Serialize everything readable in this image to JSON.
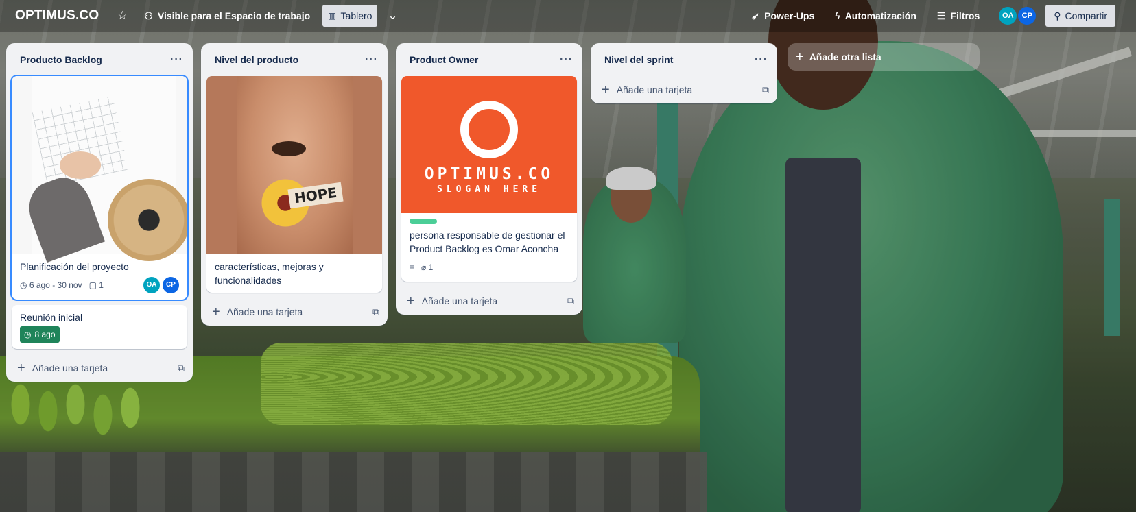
{
  "topbar": {
    "workspace_name": "OPTIMUS.CO",
    "visibility_label": "Visible para el Espacio de trabajo",
    "view_label": "Tablero",
    "powerups_label": "Power-Ups",
    "automation_label": "Automatización",
    "filters_label": "Filtros",
    "share_label": "Compartir",
    "members": [
      "OA",
      "CP"
    ]
  },
  "lists": [
    {
      "title": "Producto Backlog",
      "cards": [
        {
          "title": "Planificación del proyecto",
          "dates": "6 ago - 30 nov",
          "comments": "1",
          "members": [
            "OA",
            "CP"
          ]
        },
        {
          "title": "Reunión inicial",
          "due": "8 ago"
        }
      ],
      "add_card_label": "Añade una tarjeta"
    },
    {
      "title": "Nivel del producto",
      "cards": [
        {
          "title": "características, mejoras y funcionalidades",
          "cover_text": "HOPE"
        }
      ],
      "add_card_label": "Añade una tarjeta"
    },
    {
      "title": "Product Owner",
      "cards": [
        {
          "cover_title": "OPTIMUS.CO",
          "cover_slogan": "SLOGAN HERE",
          "title": "persona responsable de gestionar el Product Backlog es Omar Aconcha",
          "attachments": "1"
        }
      ],
      "add_card_label": "Añade una tarjeta"
    },
    {
      "title": "Nivel del sprint",
      "cards": [],
      "add_card_label": "Añade una tarjeta"
    }
  ],
  "add_list_label": "Añade otra lista",
  "colors": {
    "avatar_oa": "#00a3bf",
    "avatar_cp": "#0c66e4",
    "due_green": "#1f845a",
    "label_green": "#4bce97",
    "logo_orange": "#f0582b"
  }
}
